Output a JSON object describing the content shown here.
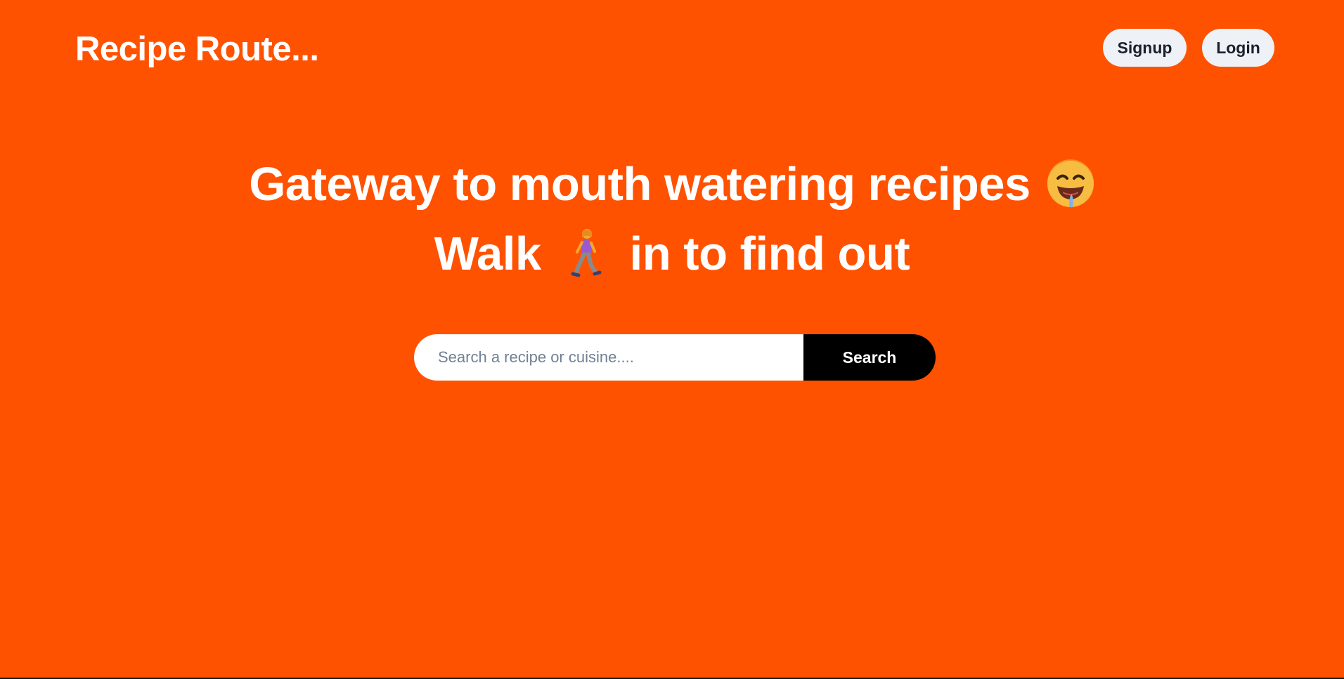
{
  "header": {
    "brand": "Recipe Route...",
    "signup_label": "Signup",
    "login_label": "Login"
  },
  "hero": {
    "line1": "Gateway to mouth watering recipes",
    "line1_icon": "drooling-face-icon",
    "line2_before": "Walk",
    "line2_icon": "woman-walking-icon",
    "line2_after": "in to find out"
  },
  "search": {
    "placeholder": "Search a recipe or cuisine....",
    "value": "",
    "button_label": "Search"
  },
  "colors": {
    "background": "#FF5200",
    "nav_button_bg": "#EEF2F6",
    "search_button_bg": "#000000",
    "text": "#FFFFFF"
  }
}
